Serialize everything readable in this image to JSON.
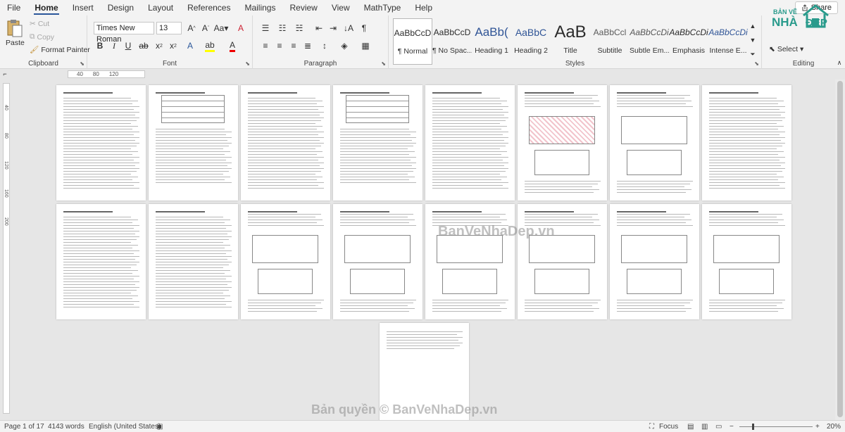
{
  "tabs": [
    "File",
    "Home",
    "Insert",
    "Design",
    "Layout",
    "References",
    "Mailings",
    "Review",
    "View",
    "MathType",
    "Help"
  ],
  "share_label": "Share",
  "clipboard": {
    "paste": "Paste",
    "cut": "Cut",
    "copy": "Copy",
    "format_painter": "Format Painter",
    "group": "Clipboard"
  },
  "font": {
    "name": "Times New Roman",
    "size": "13",
    "group": "Font"
  },
  "paragraph": {
    "group": "Paragraph"
  },
  "styles": {
    "group": "Styles",
    "items": [
      {
        "preview": "AaBbCcD",
        "name": "¶ Normal"
      },
      {
        "preview": "AaBbCcD",
        "name": "¶ No Spac..."
      },
      {
        "preview": "AaBb(",
        "name": "Heading 1"
      },
      {
        "preview": "AaBbC",
        "name": "Heading 2"
      },
      {
        "preview": "AaB",
        "name": "Title"
      },
      {
        "preview": "AaBbCcl",
        "name": "Subtitle"
      },
      {
        "preview": "AaBbCcDi",
        "name": "Subtle Em..."
      },
      {
        "preview": "AaBbCcDi",
        "name": "Emphasis"
      },
      {
        "preview": "AaBbCcDi",
        "name": "Intense E..."
      }
    ]
  },
  "editing": {
    "select": "Select",
    "group": "Editing"
  },
  "logo": {
    "line1": "BẢN VẼ",
    "line2": "NHÀ",
    "line3": "ĐẸP"
  },
  "ruler": {
    "marks": [
      "40",
      "80",
      "120"
    ]
  },
  "vruler": {
    "marks": [
      "40",
      "80",
      "120",
      "160",
      "200"
    ]
  },
  "watermark": {
    "center": "BanVeNhaDep.vn",
    "bottom": "Bản quyền © BanVeNhaDep.vn"
  },
  "status": {
    "page": "Page 1 of 17",
    "words": "4143 words",
    "language": "English (United States)",
    "focus": "Focus",
    "zoom": "20%"
  }
}
